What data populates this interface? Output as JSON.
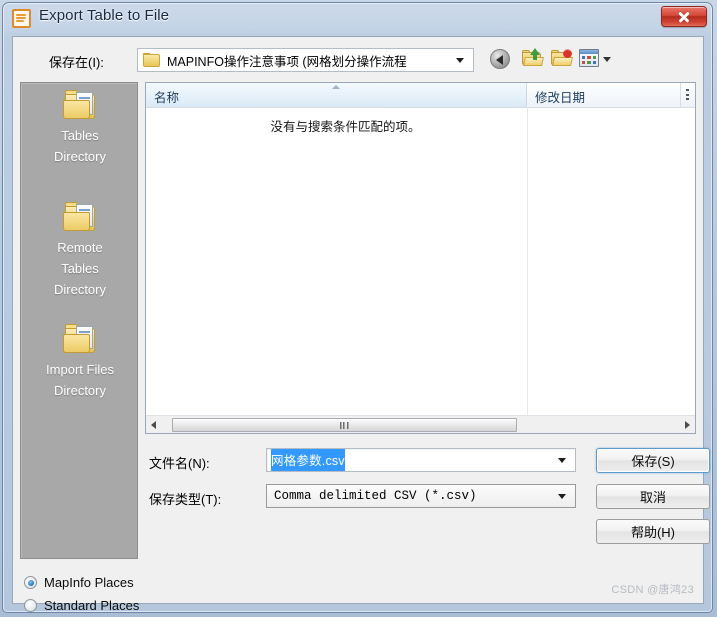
{
  "window": {
    "title": "Export Table to File",
    "icon": "document-icon",
    "close_label": "x"
  },
  "toolbar": {
    "save_in_label": "保存在(I):",
    "current_path": "MAPINFO操作注意事项 (网格划分操作流程",
    "buttons": [
      {
        "name": "back-button",
        "icon": "back-arrow-icon"
      },
      {
        "name": "up-folder-button",
        "icon": "up-folder-icon"
      },
      {
        "name": "new-folder-button",
        "icon": "new-folder-icon"
      },
      {
        "name": "views-button",
        "icon": "views-grid-icon"
      }
    ]
  },
  "places": {
    "items": [
      {
        "lines": [
          "Tables",
          "Directory"
        ]
      },
      {
        "lines": [
          "Remote",
          "Tables",
          "Directory"
        ]
      },
      {
        "lines": [
          "Import Files",
          "Directory"
        ]
      }
    ]
  },
  "file_list": {
    "columns": [
      {
        "label": "名称",
        "sorted": "ascending"
      },
      {
        "label": "修改日期",
        "sorted": "none"
      }
    ],
    "empty_message": "没有与搜索条件匹配的项。",
    "rows": []
  },
  "form": {
    "filename_label": "文件名(N):",
    "filename_value": "网格参数.csv",
    "filetype_label": "保存类型(T):",
    "filetype_value": "Comma delimited CSV (*.csv)"
  },
  "buttons": {
    "save": "保存(S)",
    "cancel": "取消",
    "help": "帮助(H)"
  },
  "places_mode": {
    "options": [
      {
        "label": "MapInfo Places",
        "selected": true
      },
      {
        "label": "Standard Places",
        "selected": false
      }
    ]
  },
  "watermark": "CSDN @唐鸿23",
  "colors": {
    "accent": "#3399ff",
    "close_red": "#c0392b",
    "places_bg": "#a8a8a8",
    "default_button_border": "#5a9bd0"
  }
}
